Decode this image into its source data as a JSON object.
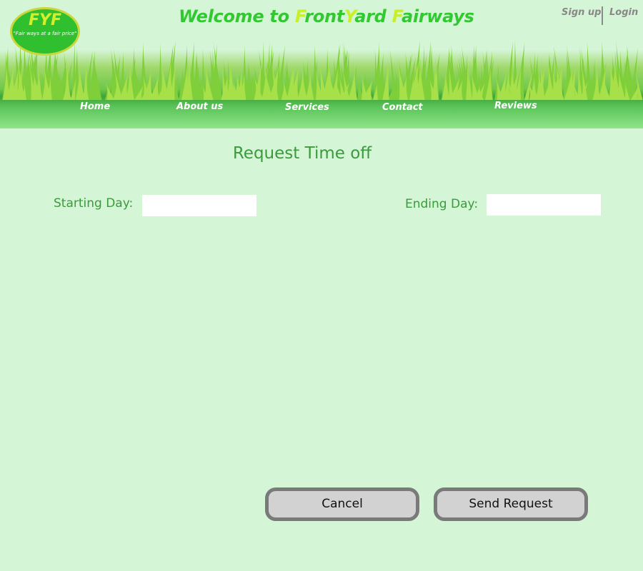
{
  "header": {
    "logo": {
      "title": "FYF",
      "tagline": "\"Fair ways at a fair price\""
    },
    "welcome": {
      "prefix": "Welcome to ",
      "f1": "F",
      "w1": "ront",
      "y1": "Y",
      "w2": "ard ",
      "f2": "F",
      "w3": "airways"
    },
    "auth": {
      "signup": "Sign up",
      "login": "Login"
    },
    "nav": [
      "Home",
      "About us",
      "Services",
      "Contact",
      "Reviews"
    ]
  },
  "main": {
    "title": "Request Time off",
    "starting_label": "Starting Day:",
    "starting_value": "",
    "ending_label": "Ending Day:",
    "ending_value": ""
  },
  "actions": {
    "cancel": "Cancel",
    "send": "Send Request"
  },
  "colors": {
    "background": "#d5f5d7",
    "accent_green": "#32c832",
    "highlight_yellow": "#c8f02a",
    "label_green": "#3b9a3b",
    "button_border": "#7a7a7a"
  }
}
